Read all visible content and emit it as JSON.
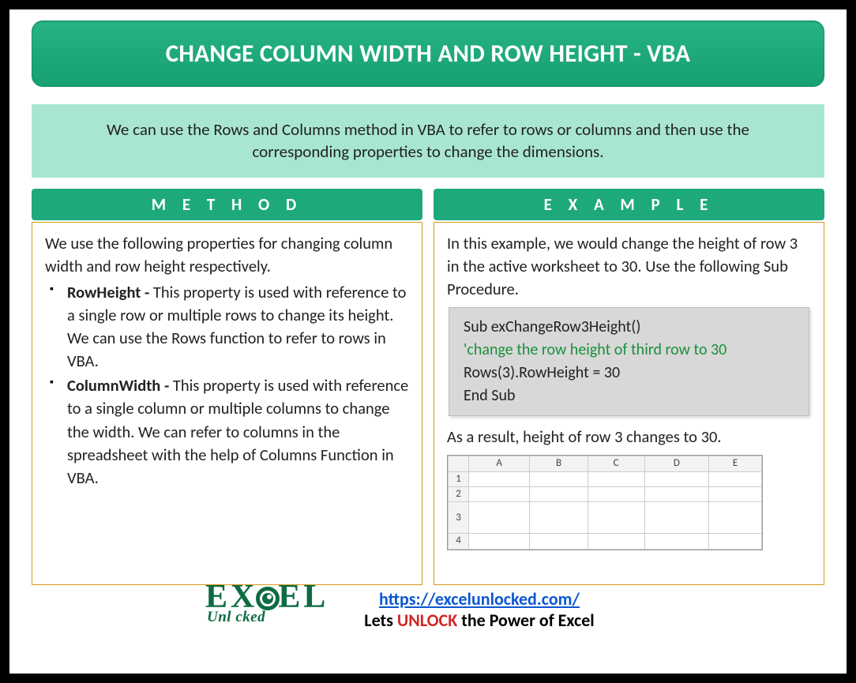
{
  "title": "CHANGE COLUMN WIDTH AND ROW HEIGHT - VBA",
  "intro": "We can use the Rows and Columns method in VBA to refer to rows or columns and then use the corresponding properties to change the dimensions.",
  "method": {
    "heading": "M E T H O D",
    "lead": "We use the following properties for changing column width and row height respectively.",
    "items": [
      {
        "name": "RowHeight",
        "desc": "This property is used with reference to a single row or multiple rows to change its height. We can use the Rows function to refer to rows in VBA."
      },
      {
        "name": "ColumnWidth",
        "desc": "This property is used with reference to a single column or multiple columns to change the width. We can refer to columns in the spreadsheet with the help of Columns Function in VBA."
      }
    ]
  },
  "example": {
    "heading": "E X A M P L E",
    "lead": "In this example, we would change the height of row 3 in the active worksheet to 30. Use the following Sub Procedure.",
    "code": {
      "line1": "Sub exChangeRow3Height()",
      "comment": "'change the row height of third row to 30",
      "line3": "Rows(3).RowHeight = 30",
      "line4": "End Sub"
    },
    "result": "As a result, height of row 3 changes to 30.",
    "sheet": {
      "columns": [
        "A",
        "B",
        "C",
        "D",
        "E"
      ],
      "rows": [
        "1",
        "2",
        "3",
        "4"
      ],
      "tall_row": "3"
    }
  },
  "footer": {
    "url": "https://excelunlocked.com/",
    "tagline_pre": "Lets ",
    "tagline_em": "UNLOCK",
    "tagline_post": " the Power of Excel",
    "logo_top_left": "EX",
    "logo_top_right": "EL",
    "logo_sub": "Unl   cked"
  }
}
